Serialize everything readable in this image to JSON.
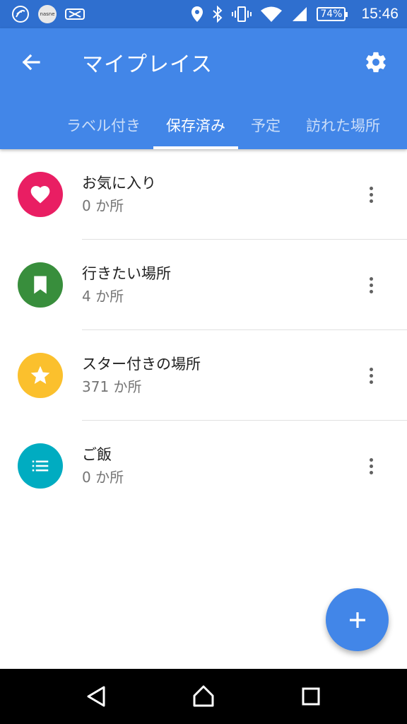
{
  "status_bar": {
    "left_icons": [
      "nfc-icon",
      "nasne-app-icon",
      "card-icon"
    ],
    "app_badge_text": "nasne",
    "right_icons": [
      "location-icon",
      "bluetooth-icon",
      "vibrate-icon",
      "wifi-icon",
      "signal-icon"
    ],
    "battery": "74%",
    "time": "15:46"
  },
  "app_bar": {
    "title": "マイプレイス",
    "back_icon": "arrow-back-icon",
    "settings_icon": "gear-icon",
    "color": "#4286e8"
  },
  "tabs": [
    {
      "label": "ラベル付き",
      "active": false
    },
    {
      "label": "保存済み",
      "active": true
    },
    {
      "label": "予定",
      "active": false
    },
    {
      "label": "訪れた場所",
      "active": false
    }
  ],
  "lists": [
    {
      "title": "お気に入り",
      "count": "0 か所",
      "icon": "heart-icon",
      "color": "#e91e63"
    },
    {
      "title": "行きたい場所",
      "count": "4 か所",
      "icon": "bookmark-icon",
      "color": "#388e3c"
    },
    {
      "title": "スター付きの場所",
      "count": "371 か所",
      "icon": "star-icon",
      "color": "#fbc02d"
    },
    {
      "title": "ご飯",
      "count": "0 か所",
      "icon": "list-icon",
      "color": "#00acc1"
    }
  ],
  "fab": {
    "icon": "plus-icon",
    "color": "#4286e8"
  },
  "nav_bar": {
    "icons": [
      "back-triangle-icon",
      "home-icon",
      "recents-icon"
    ]
  }
}
